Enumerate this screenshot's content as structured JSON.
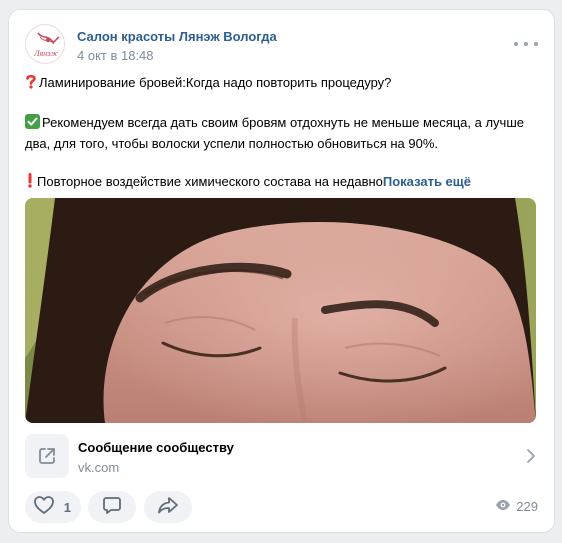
{
  "post": {
    "author": "Салон красоты Лянэж Вологда",
    "date": "4 окт в 18:48",
    "avatar_text": "Лянэж",
    "paragraphs": [
      {
        "emoji": "question-mark-icon",
        "text": "Ламинирование бровей:Когда надо повторить процедуру?"
      },
      {
        "emoji": "check-mark-icon",
        "text": "Рекомендуем всегда дать своим бровям отдохнуть не меньше месяца, а лучше два, для того, чтобы волоски успели полностью обновиться на 90%."
      },
      {
        "emoji": "exclamation-mark-icon",
        "text": "Повторное воздействие химического состава на недавно"
      }
    ],
    "show_more": "Показать ещё"
  },
  "link": {
    "title": "Сообщение сообществу",
    "domain": "vk.com"
  },
  "actions": {
    "like_count": "1",
    "views": "229"
  },
  "colors": {
    "link_blue": "#2c5f91",
    "secondary": "#818c99",
    "button_bg": "#f0f2f5",
    "page_bg": "#edeef0"
  }
}
